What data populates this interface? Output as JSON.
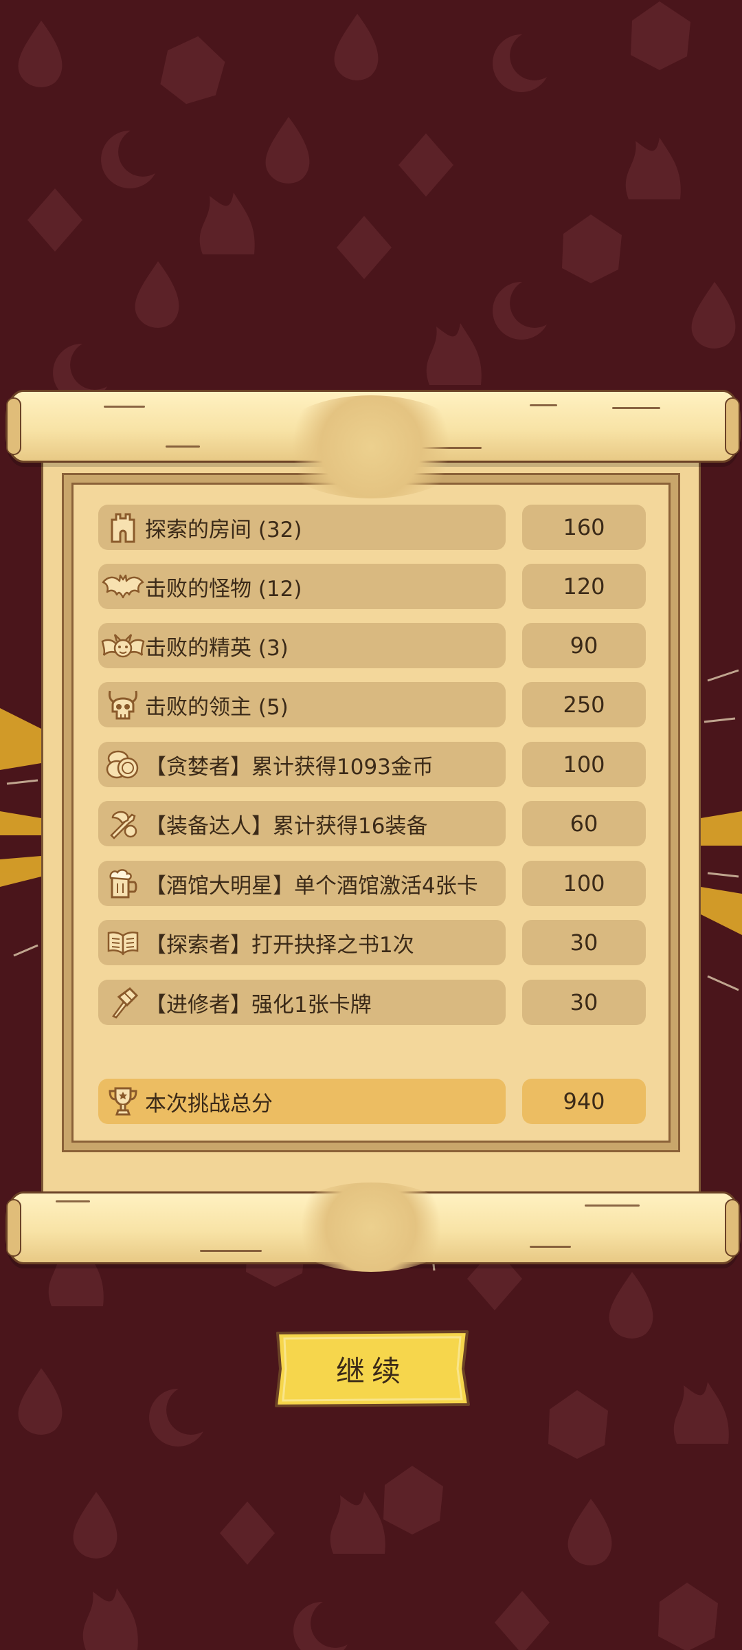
{
  "score_rows": [
    {
      "icon": "tower-icon",
      "label": "探索的房间 (32)",
      "value": "160"
    },
    {
      "icon": "bat-icon",
      "label": "击败的怪物 (12)",
      "value": "120"
    },
    {
      "icon": "winged-demon-icon",
      "label": "击败的精英 (3)",
      "value": "90"
    },
    {
      "icon": "horned-skull-icon",
      "label": "击败的领主 (5)",
      "value": "250"
    },
    {
      "icon": "coins-icon",
      "label": "【贪婪者】累计获得1093金币",
      "value": "100"
    },
    {
      "icon": "equipment-icon",
      "label": "【装备达人】累计获得16装备",
      "value": "60"
    },
    {
      "icon": "beer-mug-icon",
      "label": "【酒馆大明星】单个酒馆激活4张卡",
      "value": "100"
    },
    {
      "icon": "open-book-icon",
      "label": "【探索者】打开抉择之书1次",
      "value": "30"
    },
    {
      "icon": "hammer-icon",
      "label": "【进修者】强化1张卡牌",
      "value": "30"
    }
  ],
  "total": {
    "icon": "trophy-icon",
    "label": "本次挑战总分",
    "value": "940"
  },
  "continue_button": {
    "label": "继续"
  },
  "colors": {
    "background": "#4a151b",
    "parchment": "#f2d597",
    "pill": "#d9b980",
    "total_pill": "#ecbd62",
    "button": "#f6d64c",
    "text": "#3b2a18"
  }
}
